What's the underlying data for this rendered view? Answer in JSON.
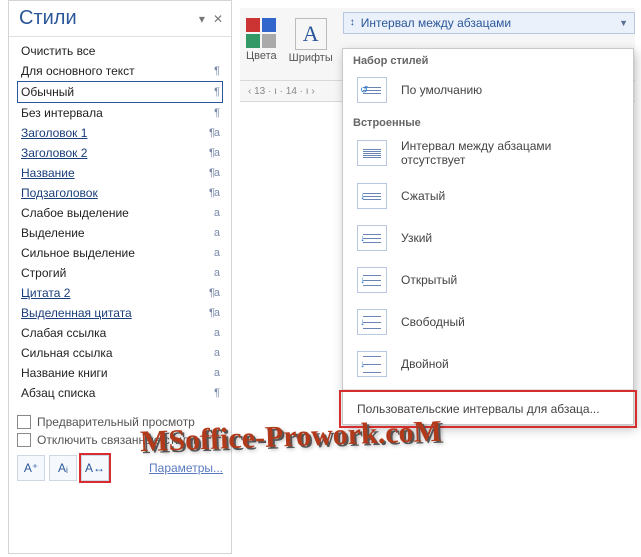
{
  "styles_panel": {
    "title": "Стили",
    "styles": [
      {
        "name": "Очистить все",
        "glyph": "",
        "underline": false
      },
      {
        "name": "Для основного текст",
        "glyph": "¶",
        "underline": false
      },
      {
        "name": "Обычный",
        "glyph": "¶",
        "underline": false,
        "selected": true
      },
      {
        "name": "Без интервала",
        "glyph": "¶",
        "underline": false
      },
      {
        "name": "Заголовок 1",
        "glyph": "¶a",
        "underline": true
      },
      {
        "name": "Заголовок 2",
        "glyph": "¶a",
        "underline": true
      },
      {
        "name": "Название",
        "glyph": "¶a",
        "underline": true
      },
      {
        "name": "Подзаголовок",
        "glyph": "¶a",
        "underline": true
      },
      {
        "name": "Слабое выделение",
        "glyph": "a",
        "underline": false
      },
      {
        "name": "Выделение",
        "glyph": "a",
        "underline": false
      },
      {
        "name": "Сильное выделение",
        "glyph": "a",
        "underline": false
      },
      {
        "name": "Строгий",
        "glyph": "a",
        "underline": false
      },
      {
        "name": "Цитата 2",
        "glyph": "¶a",
        "underline": true
      },
      {
        "name": "Выделенная цитата",
        "glyph": "¶a",
        "underline": true
      },
      {
        "name": "Слабая ссылка",
        "glyph": "a",
        "underline": false
      },
      {
        "name": "Сильная ссылка",
        "glyph": "a",
        "underline": false
      },
      {
        "name": "Название книги",
        "glyph": "a",
        "underline": false
      },
      {
        "name": "Абзац списка",
        "glyph": "¶",
        "underline": false
      }
    ],
    "checkboxes": {
      "preview": "Предварительный просмотр",
      "disable_linked": "Отключить связанные стили"
    },
    "params_link": "Параметры..."
  },
  "ribbon": {
    "colors": "Цвета",
    "fonts": "Шрифты",
    "spacing_label": "Интервал между абзацами",
    "ruler": "‹ 13 · ı · 14 · ı ›"
  },
  "dropdown": {
    "section_sets": "Набор стилей",
    "default": "По умолчанию",
    "section_builtin": "Встроенные",
    "items": [
      "Интервал между абзацами отсутствует",
      "Сжатый",
      "Узкий",
      "Открытый",
      "Свободный",
      "Двойной"
    ],
    "custom": "Пользовательские интервалы для абзаца..."
  },
  "watermark": "MSoffice-Prowork.coM"
}
